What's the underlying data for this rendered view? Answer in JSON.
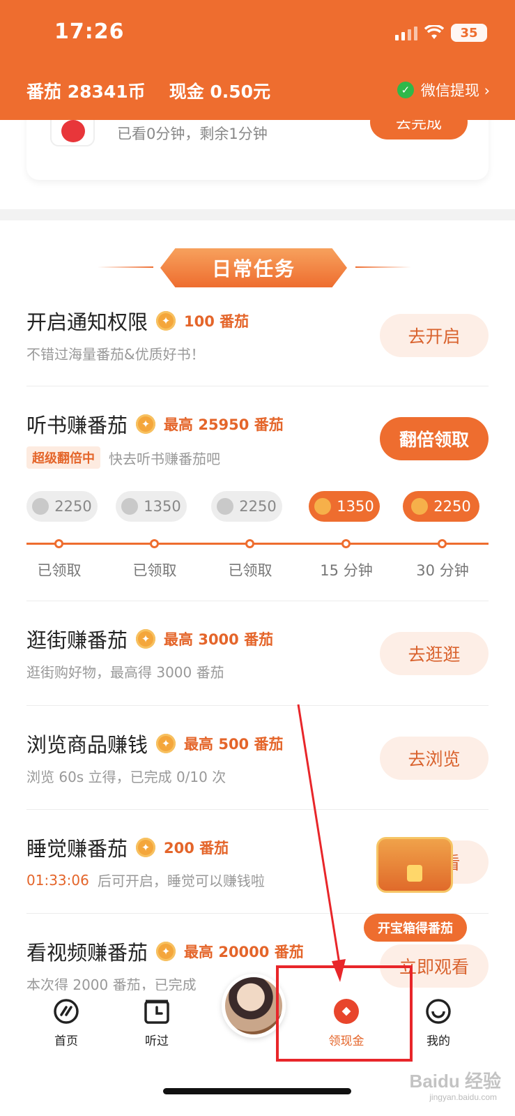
{
  "status_bar": {
    "time": "17:26",
    "battery": "35"
  },
  "header": {
    "balance_tomato": "番茄 28341币",
    "balance_cash": "现金 0.50元",
    "wechat_withdraw": "微信提现 ›"
  },
  "top_card": {
    "desc": "已看0分钟，剩余1分钟",
    "button": "去完成"
  },
  "section_title": "日常任务",
  "tasks": [
    {
      "title": "开启通知权限",
      "reward": "100 番茄",
      "desc": "不错过海量番茄&优质好书！",
      "button": "去开启"
    },
    {
      "title": "听书赚番茄",
      "reward": "最高 25950 番茄",
      "tag": "超级翻倍中",
      "desc": "快去听书赚番茄吧",
      "button": "翻倍领取"
    },
    {
      "title": "逛街赚番茄",
      "reward": "最高 3000 番茄",
      "desc": "逛街购好物，最高得 3000 番茄",
      "button": "去逛逛"
    },
    {
      "title": "浏览商品赚钱",
      "reward": "最高 500 番茄",
      "desc": "浏览 60s 立得，已完成 0/10 次",
      "button": "去浏览"
    },
    {
      "title": "睡觉赚番茄",
      "reward": "200 番茄",
      "countdown": "01:33:06",
      "desc": "后可开启，睡觉可以赚钱啦",
      "button": "去查看"
    },
    {
      "title": "看视频赚番茄",
      "reward": "最高 20000 番茄",
      "desc": "本次得 2000 番茄，已完成",
      "button": "立即观看"
    }
  ],
  "listen_progress": [
    {
      "amount": "2250",
      "label": "已领取"
    },
    {
      "amount": "1350",
      "label": "已领取"
    },
    {
      "amount": "2250",
      "label": "已领取"
    },
    {
      "amount": "1350",
      "label": "15 分钟"
    },
    {
      "amount": "2250",
      "label": "30 分钟"
    }
  ],
  "chest_label": "开宝箱得番茄",
  "bottom_nav": {
    "home": "首页",
    "listened": "听过",
    "cash": "领现金",
    "mine": "我的"
  },
  "watermark": {
    "brand": "Baidu 经验",
    "url": "jingyan.baidu.com"
  },
  "colors": {
    "accent": "#ee6d2f",
    "annotation": "#e8262a"
  }
}
